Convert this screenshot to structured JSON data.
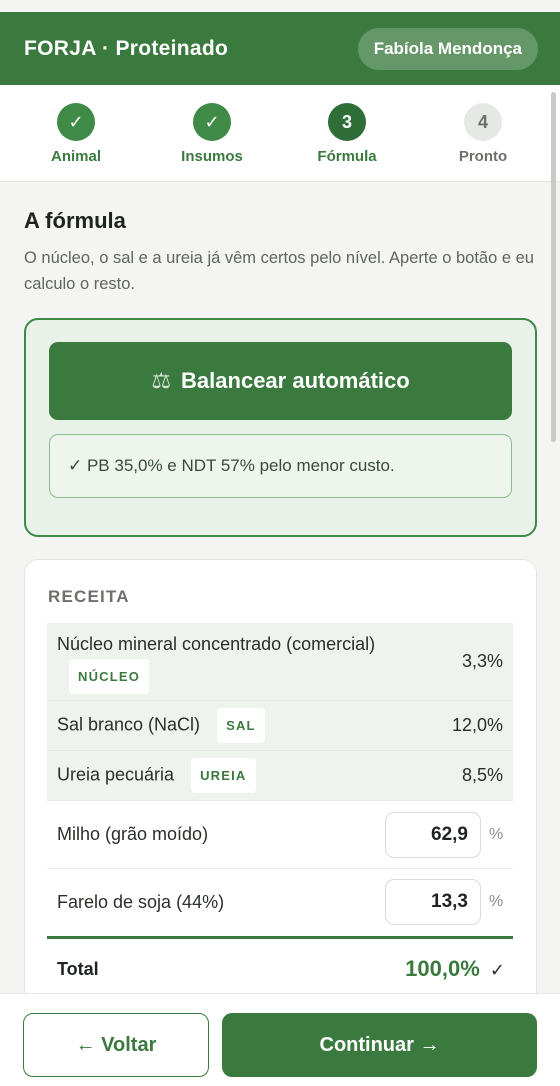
{
  "header": {
    "title": "FORJA · Proteinado",
    "user": "Fabíola Mendonça"
  },
  "steps": [
    {
      "label": "Animal",
      "status": "done",
      "mark": "✓"
    },
    {
      "label": "Insumos",
      "status": "done",
      "mark": "✓"
    },
    {
      "label": "Fórmula",
      "status": "current",
      "mark": "3"
    },
    {
      "label": "Pronto",
      "status": "todo",
      "mark": "4"
    }
  ],
  "section": {
    "title": "A fórmula",
    "description": "O núcleo, o sal e a ureia já vêm certos pelo nível. Aperte o botão e eu calculo o resto."
  },
  "balance": {
    "icon": "scale-icon",
    "button_label": "Balancear automático",
    "result": "✓ PB 35,0% e NDT 57% pelo menor custo."
  },
  "recipe": {
    "heading": "RECEITA",
    "fixed_rows": [
      {
        "name": "Núcleo mineral concentrado (comercial)",
        "tag": "NÚCLEO",
        "value": "3,3%"
      },
      {
        "name": "Sal branco (NaCl)",
        "tag": "SAL",
        "value": "12,0%"
      },
      {
        "name": "Ureia pecuária",
        "tag": "UREIA",
        "value": "8,5%"
      }
    ],
    "editable_rows": [
      {
        "name": "Milho (grão moído)",
        "value": "62,9",
        "unit": "%"
      },
      {
        "name": "Farelo de soja (44%)",
        "value": "13,3",
        "unit": "%"
      }
    ],
    "total_label": "Total",
    "total_value": "100,0%",
    "total_check": "✓"
  },
  "footer": {
    "back_label": "← Voltar",
    "next_label": "Continuar →"
  },
  "colors": {
    "primary": "#3b7a3e",
    "light_green": "#e9f2e8"
  }
}
